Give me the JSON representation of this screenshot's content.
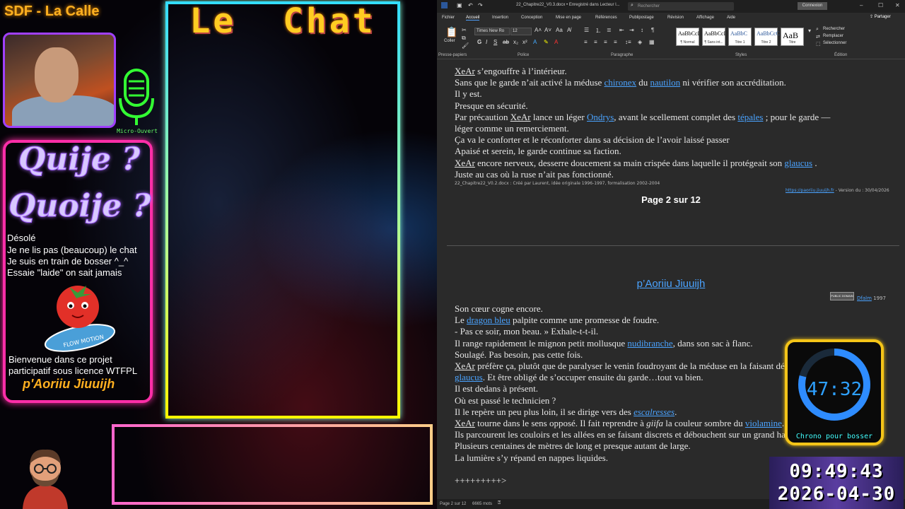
{
  "stream": {
    "title": "SDF - La Calle",
    "mic_label": "Micro-Ouvert",
    "chat_title": "Le  Chat",
    "heading1": "Quije ?",
    "heading2": "Quoije ?",
    "messages": [
      "Désolé",
      "Je ne lis pas (beaucoup) le chat",
      "Je suis en train de bosser ^_^",
      "Essaie \"laide\" on sait jamais"
    ],
    "tomato_banner": "FLOW MOTION",
    "welcome": [
      "Bienvenue dans ce projet",
      "participatif sous licence WTFPL"
    ],
    "signature": "p'Aoriiu Jiuuijh"
  },
  "word": {
    "window_title": "22_Chapitre22_V0.3.docx • Enregistré dans Lecteur l...",
    "search_placeholder": "Rechercher",
    "connect_label": "Connexion",
    "tabs": [
      "Fichier",
      "Accueil",
      "Insertion",
      "Conception",
      "Mise en page",
      "Références",
      "Publipostage",
      "Révision",
      "Affichage",
      "Aide"
    ],
    "share_label": "Partager",
    "paste_label": "Coller",
    "font_name": "Times New Ro",
    "font_size": "12",
    "styles": [
      {
        "sample": "AaBbCcI",
        "name": "¶ Normal"
      },
      {
        "sample": "AaBbCcI",
        "name": "¶ Sans int..."
      },
      {
        "sample": "AaBbC",
        "name": "Titre 1"
      },
      {
        "sample": "AaBbCcC",
        "name": "Titre 2"
      },
      {
        "sample": "AaB",
        "name": "Titre"
      }
    ],
    "editing": [
      "Rechercher",
      "Remplacer",
      "Sélectionner"
    ],
    "group_labels": [
      "Presse-papiers",
      "Police",
      "Paragraphe",
      "Styles",
      "Édition"
    ],
    "page1_lines": [
      [
        {
          "t": "XeAr",
          "u": true,
          "c": false
        },
        {
          "t": " s’engouffre à l’intérieur.",
          "u": false,
          "c": false
        }
      ],
      [
        {
          "t": "Sans que le garde n’ait activé la méduse ",
          "u": false,
          "c": false
        },
        {
          "t": "chironex",
          "u": true,
          "c": true
        },
        {
          "t": " du ",
          "u": false,
          "c": false
        },
        {
          "t": "nautilon",
          "u": true,
          "c": true
        },
        {
          "t": " ni vérifier son accréditation.",
          "u": false,
          "c": false
        }
      ],
      [
        {
          "t": "Il y est.",
          "u": false,
          "c": false
        }
      ],
      [
        {
          "t": "Presque en sécurité.",
          "u": false,
          "c": false
        }
      ],
      [
        {
          "t": "Par précaution ",
          "u": false,
          "c": false
        },
        {
          "t": "XeAr",
          "u": true,
          "c": false
        },
        {
          "t": " lance un léger ",
          "u": false,
          "c": false
        },
        {
          "t": "Ondrys",
          "u": true,
          "c": true
        },
        {
          "t": ", avant le scellement complet des ",
          "u": false,
          "c": false
        },
        {
          "t": "tépales",
          "u": true,
          "c": true
        },
        {
          "t": " ; pour le garde —",
          "u": false,
          "c": false
        }
      ],
      [
        {
          "t": "léger comme un remerciement.",
          "u": false,
          "c": false
        }
      ],
      [
        {
          "t": "Ça va le conforter et le réconforter dans sa décision de l’avoir laissé passer",
          "u": false,
          "c": false
        }
      ],
      [
        {
          "t": "Apaisé et serein, le garde continue sa faction.",
          "u": false,
          "c": false
        }
      ],
      [
        {
          "t": "XeAr",
          "u": true,
          "c": false
        },
        {
          "t": " encore nerveux, desserre doucement sa main crispée dans laquelle il protégeait son ",
          "u": false,
          "c": false
        },
        {
          "t": "glaucus",
          "u": true,
          "c": true
        },
        {
          "t": " .",
          "u": false,
          "c": false
        }
      ],
      [
        {
          "t": "Juste au cas où la ruse n’ait pas fonctionné.",
          "u": false,
          "c": false
        }
      ]
    ],
    "footer_left": "22_Chapitre22_V0.2.docx : Créé par Laurent, idée originale 1996-1997, formalisation 2002-2004",
    "footer_link": "https://paoriiu.jiuuijh.fr",
    "footer_version": " - Version du : 30/04/2026",
    "page_number": "Page 2 sur 12",
    "doc_author": "p’Aoriiu Jiuuijh",
    "cc_text": "PUBLIC DOMAIN",
    "doc_date_name": "Dfalm",
    "doc_date_year": " 1997",
    "page2_lines": [
      [
        {
          "t": "Son cœur cogne encore.",
          "u": false,
          "c": false
        }
      ],
      [
        {
          "t": "Le ",
          "u": false,
          "c": false
        },
        {
          "t": "dragon bleu",
          "u": true,
          "c": true
        },
        {
          "t": " palpite comme une promesse de foudre.",
          "u": false,
          "c": false
        }
      ],
      [
        {
          "t": "     -     Pas ce soir, mon beau. » Exhale-t-t-il.",
          "u": false,
          "c": false
        }
      ],
      [
        {
          "t": "Il range rapidement le mignon petit mollusque ",
          "u": false,
          "c": false
        },
        {
          "t": "nudibranche",
          "u": true,
          "c": true
        },
        {
          "t": ", dans son sac à flanc.",
          "u": false,
          "c": false
        }
      ],
      [
        {
          "t": "Soulagé. Pas besoin, pas cette fois.",
          "u": false,
          "c": false
        }
      ],
      [
        {
          "t": "XeAr",
          "u": true,
          "c": false
        },
        {
          "t": " préfère ça, plutôt que de paralyser le venin foudroyant de la méduse en la faisant dévorer par son",
          "u": false,
          "c": false
        }
      ],
      [
        {
          "t": "glaucus",
          "u": true,
          "c": true
        },
        {
          "t": ". Et être obligé de s’occuper ensuite du garde…tout va bien.",
          "u": false,
          "c": false
        }
      ],
      [
        {
          "t": "Il est dedans à présent.",
          "u": false,
          "c": false
        }
      ],
      [
        {
          "t": "Où est passé le technicien ?",
          "u": false,
          "c": false
        }
      ],
      [
        {
          "t": "Il le repère un peu plus loin, il se dirige vers des ",
          "u": false,
          "c": false
        },
        {
          "t": "escalresses",
          "u": true,
          "c": true
        },
        {
          "t": ".",
          "u": false,
          "c": false
        }
      ],
      [
        {
          "t": "XeAr",
          "u": true,
          "c": false
        },
        {
          "t": " tourne dans le sens opposé. Il fait reprendre à ",
          "u": false,
          "c": false
        },
        {
          "t": "giifa",
          "u": false,
          "c": false
        },
        {
          "t": " la couleur sombre du ",
          "u": false,
          "c": false
        },
        {
          "t": "violamine",
          "u": true,
          "c": true
        },
        {
          "t": ".",
          "u": false,
          "c": false
        }
      ],
      [
        {
          "t": "Ils parcourent les couloirs et les allées en se faisant discrets et débouchent sur un grand hall.",
          "u": false,
          "c": false
        }
      ],
      [
        {
          "t": "Plusieurs centaines de mètres de long et presque autant de large.",
          "u": false,
          "c": false
        }
      ],
      [
        {
          "t": "La lumière s’y répand en nappes liquides.",
          "u": false,
          "c": false
        }
      ],
      [
        {
          "t": "",
          "u": false,
          "c": false
        }
      ],
      [
        {
          "t": "+++++++++>",
          "u": false,
          "c": false
        }
      ]
    ],
    "status_page": "Page 2 sur 12",
    "status_words": "6665 mots"
  },
  "chrono": {
    "time": "47:32",
    "label": "Chrono pour bosser",
    "progress": 0.79,
    "ring_color": "#2e8cff"
  },
  "clock": {
    "time": "09:49:43",
    "date": "2026-04-30"
  }
}
